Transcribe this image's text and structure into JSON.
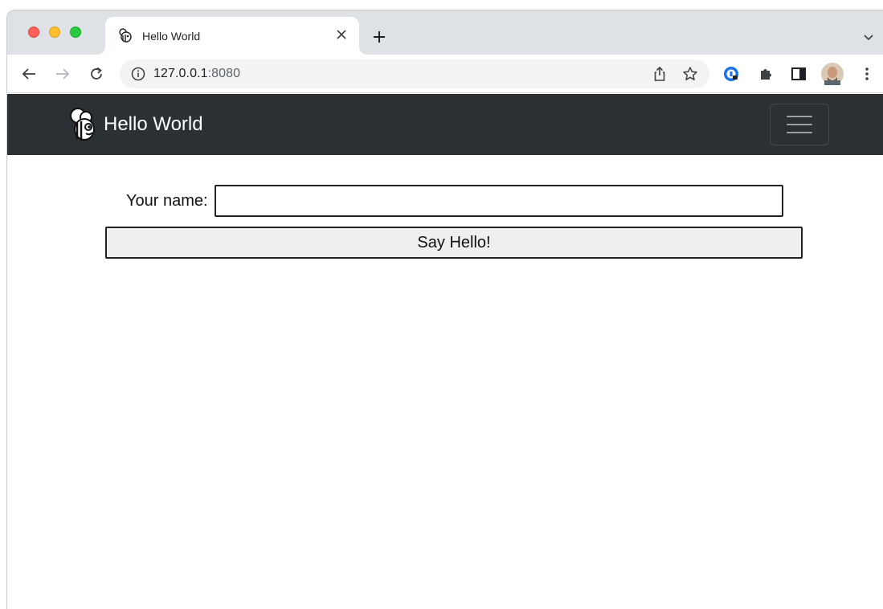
{
  "browser": {
    "tab": {
      "title": "Hello World",
      "favicon": "bee-logo-icon"
    },
    "url": {
      "host": "127.0.0.1",
      "port": ":8080"
    },
    "icons": {
      "back": "arrow-left-icon",
      "forward": "arrow-right-icon",
      "reload": "reload-icon",
      "info": "info-icon",
      "share": "share-icon",
      "bookmark": "star-icon",
      "extension_1": "password-manager-icon",
      "extensions": "puzzle-icon",
      "side_panel": "side-panel-icon",
      "profile": "profile-avatar",
      "menu": "kebab-menu-icon"
    }
  },
  "navbar": {
    "brand": "Hello World",
    "background": "#2b3035"
  },
  "form": {
    "name_label": "Your name:",
    "name_value": "",
    "button_label": "Say Hello!"
  }
}
